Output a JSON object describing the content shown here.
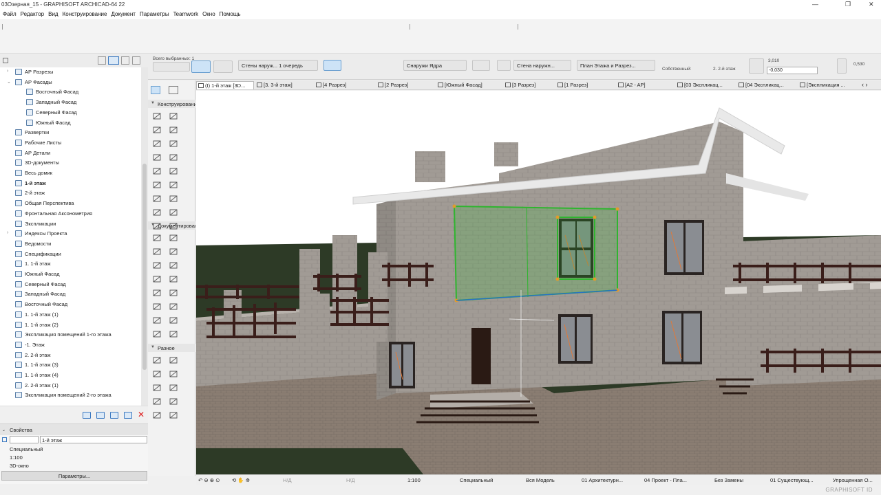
{
  "window": {
    "title": "03Озерная_15 - GRAPHISOFT ARCHICAD-64 22",
    "minimize": "—",
    "restore": "❐",
    "close": "✕"
  },
  "menu": [
    "Файл",
    "Редактор",
    "Вид",
    "Конструирование",
    "Документ",
    "Параметры",
    "Teamwork",
    "Окно",
    "Помощь"
  ],
  "infobox": {
    "selection_label": "Всего выбранных: 1",
    "layer_label": "Стены наруж... 1 очередь",
    "core_label": "Снаружи Ядра",
    "composite_label": "Стена наружн...",
    "structure_label": "План Этажа и Разрез...",
    "home_story_label": "Собственный:",
    "home_story_value": "2. 2-й этаж",
    "value_1": "3,010",
    "value_2": "-0,030",
    "value_3": "0,530"
  },
  "navigator": {
    "items": [
      {
        "label": "АР Разрезы",
        "indent": 1,
        "arrow": "›",
        "bold": false
      },
      {
        "label": "АР Фасады",
        "indent": 1,
        "arrow": "⌄",
        "bold": false
      },
      {
        "label": "Восточный Фасад",
        "indent": 2,
        "arrow": "",
        "bold": false
      },
      {
        "label": "Западный Фасад",
        "indent": 2,
        "arrow": "",
        "bold": false
      },
      {
        "label": "Северный Фасад",
        "indent": 2,
        "arrow": "",
        "bold": false
      },
      {
        "label": "Южный Фасад",
        "indent": 2,
        "arrow": "",
        "bold": false
      },
      {
        "label": "Развертки",
        "indent": 1,
        "arrow": "",
        "bold": false
      },
      {
        "label": "Рабочие Листы",
        "indent": 1,
        "arrow": "",
        "bold": false
      },
      {
        "label": "АР Детали",
        "indent": 1,
        "arrow": "",
        "bold": false
      },
      {
        "label": "3D-документы",
        "indent": 1,
        "arrow": "",
        "bold": false
      },
      {
        "label": "Весь домик",
        "indent": 1,
        "arrow": "",
        "bold": false
      },
      {
        "label": "1-й этаж",
        "indent": 1,
        "arrow": "",
        "bold": true
      },
      {
        "label": "2-й этаж",
        "indent": 1,
        "arrow": "",
        "bold": false
      },
      {
        "label": "Общая Перспектива",
        "indent": 1,
        "arrow": "",
        "bold": false
      },
      {
        "label": "Фронтальная Аксонометрия",
        "indent": 1,
        "arrow": "",
        "bold": false
      },
      {
        "label": "Экспликации",
        "indent": 1,
        "arrow": "",
        "bold": false
      },
      {
        "label": "Индексы Проекта",
        "indent": 1,
        "arrow": "›",
        "bold": false
      },
      {
        "label": "Ведомости",
        "indent": 1,
        "arrow": "",
        "bold": false
      },
      {
        "label": "Спецификации",
        "indent": 1,
        "arrow": "",
        "bold": false
      },
      {
        "label": "1. 1-й этаж",
        "indent": 1,
        "arrow": "",
        "bold": false
      },
      {
        "label": "Южный Фасад",
        "indent": 1,
        "arrow": "",
        "bold": false
      },
      {
        "label": "Северный Фасад",
        "indent": 1,
        "arrow": "",
        "bold": false
      },
      {
        "label": "Западный Фасад",
        "indent": 1,
        "arrow": "",
        "bold": false
      },
      {
        "label": "Восточный Фасад",
        "indent": 1,
        "arrow": "",
        "bold": false
      },
      {
        "label": "1. 1-й этаж (1)",
        "indent": 1,
        "arrow": "",
        "bold": false
      },
      {
        "label": "1. 1-й этаж (2)",
        "indent": 1,
        "arrow": "",
        "bold": false
      },
      {
        "label": "Экспликация помещений 1-го этажа",
        "indent": 1,
        "arrow": "",
        "bold": false
      },
      {
        "label": "-1. Этаж",
        "indent": 1,
        "arrow": "",
        "bold": false
      },
      {
        "label": "2. 2-й этаж",
        "indent": 1,
        "arrow": "",
        "bold": false
      },
      {
        "label": "1. 1-й этаж (3)",
        "indent": 1,
        "arrow": "",
        "bold": false
      },
      {
        "label": "1. 1-й этаж (4)",
        "indent": 1,
        "arrow": "",
        "bold": false
      },
      {
        "label": "2. 2-й этаж (1)",
        "indent": 1,
        "arrow": "",
        "bold": false
      },
      {
        "label": "Экспликация помещений 2-го этажа",
        "indent": 1,
        "arrow": "",
        "bold": false
      }
    ]
  },
  "properties": {
    "header": "Свойства",
    "name_value": "1-й этаж",
    "row_1": "Специальный",
    "row_2": "1:100",
    "row_3": "3D-окно",
    "button": "Параметры..."
  },
  "toolbox": {
    "section_1": "Конструирование",
    "section_2": "Документирование",
    "section_3": "Разное"
  },
  "tabs": [
    {
      "label": "(I) 1-й этаж [3D...",
      "active": true
    },
    {
      "label": "[3. 3-й этаж]",
      "active": false
    },
    {
      "label": "[4 Разрез]",
      "active": false
    },
    {
      "label": "[2 Разрез]",
      "active": false
    },
    {
      "label": "[Южный Фасад]",
      "active": false
    },
    {
      "label": "[3 Разрез]",
      "active": false
    },
    {
      "label": "[1 Разрез]",
      "active": false
    },
    {
      "label": "[A2 - AP]",
      "active": false
    },
    {
      "label": "[03 Экспликац...",
      "active": false
    },
    {
      "label": "[04 Экспликац...",
      "active": false
    },
    {
      "label": "[Экспликация ...",
      "active": false
    }
  ],
  "statusbar": {
    "nd_1": "Н/Д",
    "nd_2": "Н/Д",
    "scale": "1:100",
    "mode": "Специальный",
    "model": "Вся Модель",
    "layer_combo": "01 Архитектурн...",
    "project": "04 Проект - Пла...",
    "override": "Без Замены",
    "renovation": "01 Существующ...",
    "view": "Упрощенная О..."
  },
  "brand": "GRAPHISOFT ID",
  "colors": {
    "sky": "#ffffff",
    "grass": "#2d3a26",
    "stone": "#9c9791",
    "roof": "#e9e9e9",
    "railing": "#3a1e1a",
    "selection": "#2fb52f"
  }
}
